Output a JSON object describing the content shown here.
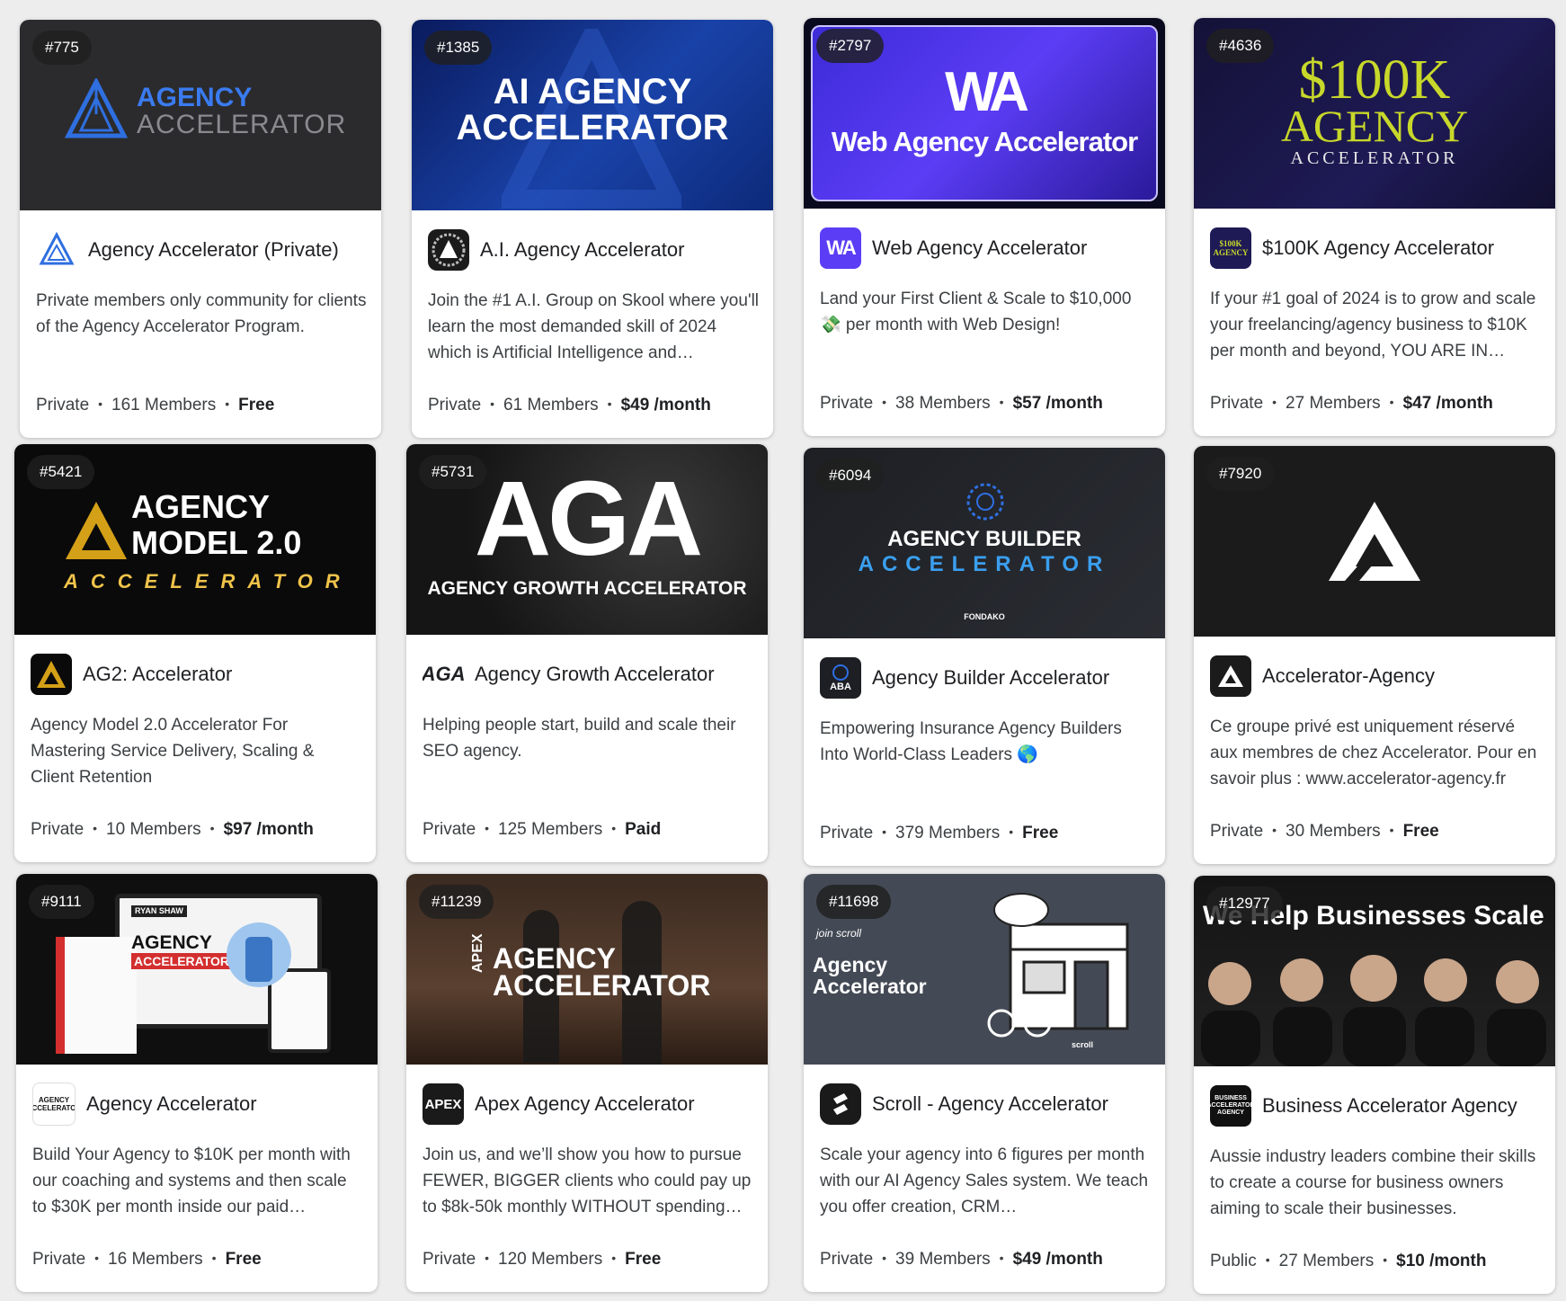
{
  "cards": [
    {
      "rank": "#775",
      "name": "Agency Accelerator (Private)",
      "desc": "Private members only community for clients of the Agency Accelerator Program.",
      "privacy": "Private",
      "members": "161 Members",
      "price": "Free",
      "banner": {
        "line1": "AGENCY",
        "line2": "ACCELERATOR"
      }
    },
    {
      "rank": "#1385",
      "name": "A.I. Agency Accelerator",
      "desc": "Join the #1 A.I. Group on Skool where you'll learn the most demanded skill of 2024 which is Artificial Intelligence and…",
      "privacy": "Private",
      "members": "61 Members",
      "price": "$49 /month",
      "banner": {
        "line1": "AI AGENCY",
        "line2": "ACCELERATOR"
      }
    },
    {
      "rank": "#2797",
      "name": "Web Agency Accelerator",
      "desc": "Land your First Client & Scale to $10,000 💸 per month with Web Design!",
      "privacy": "Private",
      "members": "38 Members",
      "price": "$57 /month",
      "logo": "WA",
      "banner": {
        "line1": "WA",
        "line2": "Web Agency Accelerator"
      }
    },
    {
      "rank": "#4636",
      "name": "$100K Agency Accelerator",
      "desc": "If your #1 goal of 2024 is to grow and scale your freelancing/agency business to $10K per month and beyond, YOU ARE IN…",
      "privacy": "Private",
      "members": "27 Members",
      "price": "$47 /month",
      "logo": "$100K AGENCY",
      "banner": {
        "line1": "$100K",
        "line2": "AGENCY",
        "line3": "ACCELERATOR"
      }
    },
    {
      "rank": "#5421",
      "name": "AG2: Accelerator",
      "desc": "Agency Model 2.0 Accelerator For Mastering Service Delivery, Scaling & Client Retention",
      "privacy": "Private",
      "members": "10 Members",
      "price": "$97 /month",
      "banner": {
        "line1": "AGENCY",
        "line2": "MODEL 2.0",
        "line3": "ACCELERATOR"
      }
    },
    {
      "rank": "#5731",
      "name": "Agency Growth Accelerator",
      "desc": "Helping people start, build and scale their SEO agency.",
      "privacy": "Private",
      "members": "125 Members",
      "price": "Paid",
      "logo": "AGA",
      "banner": {
        "line1": "AGA",
        "line2": "AGENCY GROWTH ACCELERATOR"
      }
    },
    {
      "rank": "#6094",
      "name": "Agency Builder Accelerator",
      "desc": "Empowering Insurance Agency Builders Into World-Class Leaders 🌎",
      "privacy": "Private",
      "members": "379 Members",
      "price": "Free",
      "logo": "ABA",
      "banner": {
        "line1": "AGENCY BUILDER",
        "line2": "ACCELERATOR",
        "line3": "FONDAKO"
      }
    },
    {
      "rank": "#7920",
      "name": "Accelerator-Agency",
      "desc": "Ce groupe privé est uniquement réservé aux membres de chez Accelerator. Pour en savoir plus : www.accelerator-agency.fr",
      "privacy": "Private",
      "members": "30 Members",
      "price": "Free"
    },
    {
      "rank": "#9111",
      "name": "Agency Accelerator",
      "desc": "Build Your Agency to $10K per month with our coaching and systems and then scale to $30K per month inside our paid…",
      "privacy": "Private",
      "members": "16 Members",
      "price": "Free",
      "logo": "AGENCY ACCELERATOR",
      "banner": {
        "line1": "AGENCY",
        "line2": "ACCELERATOR",
        "line3": "RYAN SHAW"
      }
    },
    {
      "rank": "#11239",
      "name": "Apex Agency Accelerator",
      "desc": "Join us, and we’ll show you how to pursue FEWER, BIGGER clients who could pay up to $8k-50k monthly WITHOUT spending…",
      "privacy": "Private",
      "members": "120 Members",
      "price": "Free",
      "logo": "APEX",
      "banner": {
        "line1": "AGENCY",
        "line2": "ACCELERATOR",
        "line3": "APEX"
      }
    },
    {
      "rank": "#11698",
      "name": "Scroll - Agency Accelerator",
      "desc": "Scale your agency into 6 figures per month with our AI Agency Sales system. We teach you offer creation, CRM…",
      "privacy": "Private",
      "members": "39 Members",
      "price": "$49 /month",
      "banner": {
        "line1": "Agency",
        "line2": "Accelerator",
        "line3": "join scroll",
        "line4": "scroll"
      }
    },
    {
      "rank": "#12977",
      "name": "Business Accelerator Agency",
      "desc": "Aussie industry leaders combine their skills to create a course for business owners aiming to scale their businesses.",
      "privacy": "Public",
      "members": "27 Members",
      "price": "$10 /month",
      "logo": "BUSINESS ACCELERATOR AGENCY",
      "banner": {
        "line1": "We Help Businesses Scale"
      }
    }
  ],
  "colors": {
    "accent_blue": "#2f6fe0",
    "gold": "#d4a017",
    "purple": "#5b3df5"
  }
}
